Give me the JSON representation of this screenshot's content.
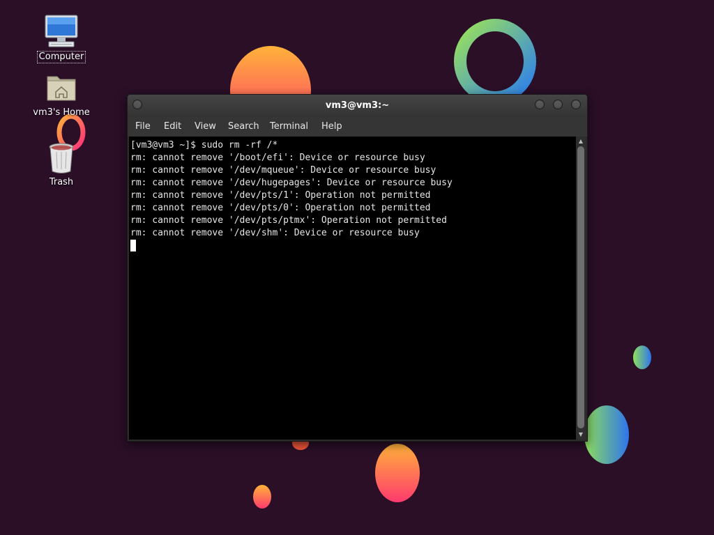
{
  "desktop": {
    "icons": [
      {
        "label": "Computer",
        "icon": "computer-icon"
      },
      {
        "label": "vm3's Home",
        "icon": "home-folder-icon"
      },
      {
        "label": "Trash",
        "icon": "trash-icon"
      }
    ]
  },
  "window": {
    "title": "vm3@vm3:~",
    "menu": [
      "File",
      "Edit",
      "View",
      "Search",
      "Terminal",
      "Help"
    ],
    "terminal_lines": [
      "[vm3@vm3 ~]$ sudo rm -rf /*",
      "rm: cannot remove '/boot/efi': Device or resource busy",
      "rm: cannot remove '/dev/mqueue': Device or resource busy",
      "rm: cannot remove '/dev/hugepages': Device or resource busy",
      "rm: cannot remove '/dev/pts/1': Operation not permitted",
      "rm: cannot remove '/dev/pts/0': Operation not permitted",
      "rm: cannot remove '/dev/pts/ptmx': Operation not permitted",
      "rm: cannot remove '/dev/shm': Device or resource busy"
    ]
  },
  "colors": {
    "desktop_bg": "#2a0f27",
    "terminal_bg": "#000000",
    "terminal_fg": "#e6e6e6",
    "titlebar": "#3d3d3d"
  }
}
